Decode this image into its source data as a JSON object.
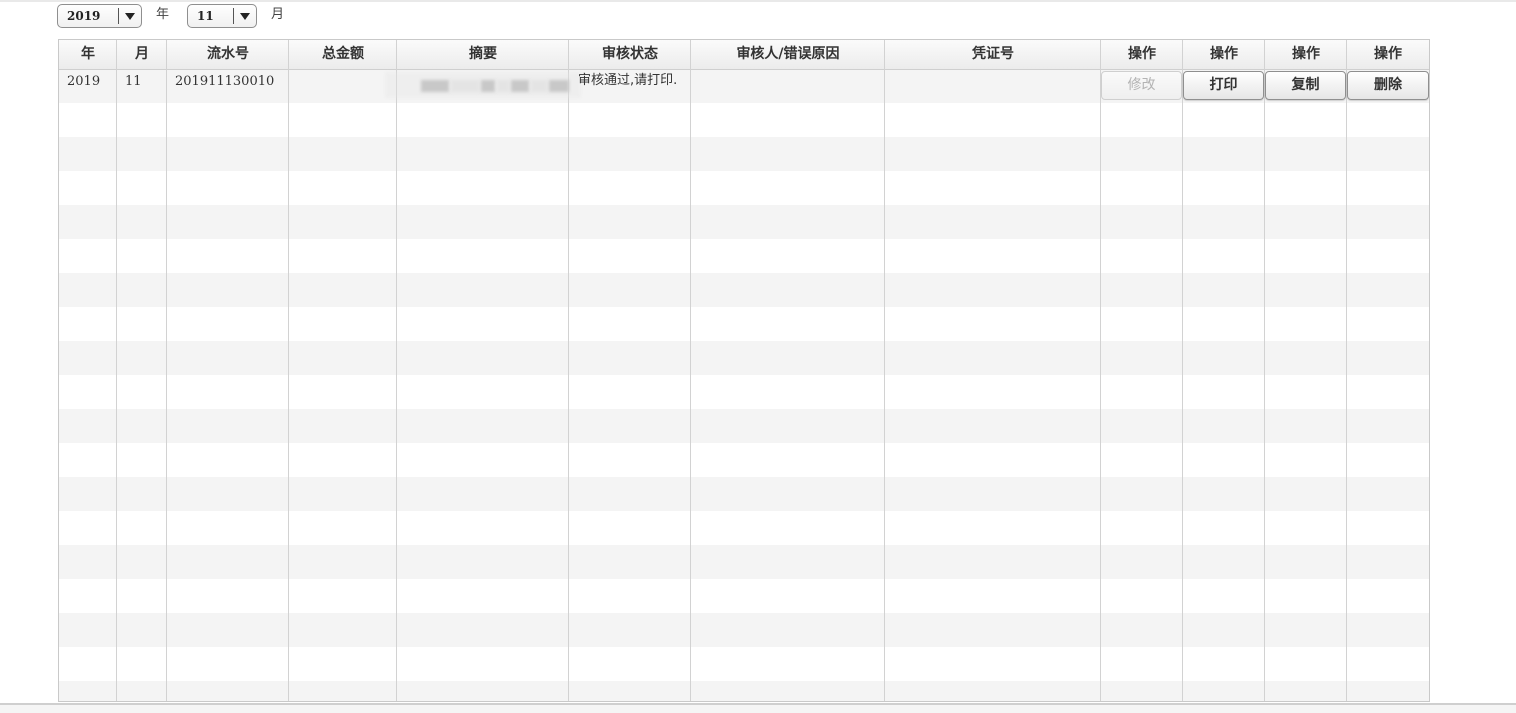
{
  "filters": {
    "year_value": "2019",
    "year_suffix": "年",
    "month_value": "11",
    "month_suffix": "月"
  },
  "table": {
    "headers": [
      "年",
      "月",
      "流水号",
      "总金额",
      "摘要",
      "审核状态",
      "审核人/错误原因",
      "凭证号",
      "操作",
      "操作",
      "操作",
      "操作"
    ],
    "rows": [
      {
        "year": "2019",
        "month": "11",
        "serial": "201911130010",
        "total": "",
        "summary": "",
        "status": "审核通过,请打印.",
        "reviewer": "",
        "voucher": "",
        "actions": [
          "修改",
          "打印",
          "复制",
          "删除"
        ]
      }
    ]
  },
  "colors": {
    "stripe": "#f4f4f4",
    "grid": "#d2d2d2",
    "disabled_text": "#b3b3b3"
  }
}
